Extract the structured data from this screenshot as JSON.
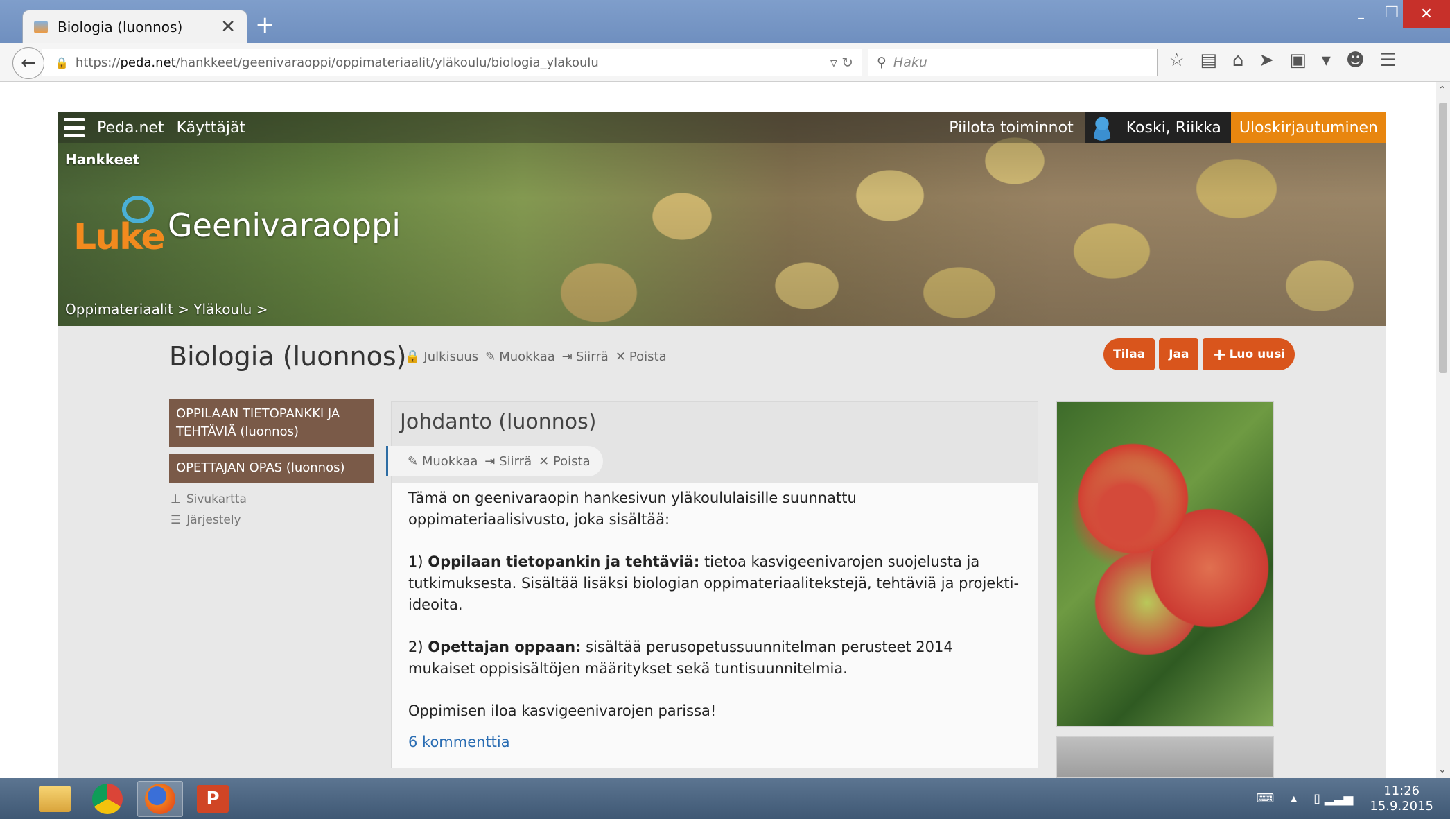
{
  "browser": {
    "tab_title": "Biologia (luonnos)",
    "new_tab": "+",
    "url_prefix": "https://",
    "url_host": "peda.net",
    "url_path": "/hankkeet/geenivaraoppi/oppimateriaalit/yläkoulu/biologia_ylakoulu",
    "search_placeholder": "Haku"
  },
  "site": {
    "topbar_links": [
      "Peda.net",
      "Käyttäjät"
    ],
    "hide_actions": "Piilota toiminnot",
    "user_name": "Koski, Riikka",
    "logout": "Uloskirjautuminen",
    "crumb_top": "Hankkeet",
    "logo_text": "Luke",
    "site_title": "Geenivaraoppi",
    "crumb_bottom": "Oppimateriaalit > Yläkoulu >"
  },
  "page": {
    "title": "Biologia (luonnos)",
    "actions": {
      "public": "Julkisuus",
      "edit": "Muokkaa",
      "move": "Siirrä",
      "delete": "Poista"
    },
    "buttons": {
      "subscribe": "Tilaa",
      "share": "Jaa",
      "create_new": "Luo uusi"
    }
  },
  "leftnav": {
    "items": [
      "OPPILAAN TIETOPANKKI JA TEHTÄVIÄ (luonnos)",
      "OPETTAJAN OPAS (luonnos)"
    ],
    "sitemap": "Sivukartta",
    "arrange": "Järjestely"
  },
  "content": {
    "title": "Johdanto (luonnos)",
    "actions": {
      "edit": "Muokkaa",
      "move": "Siirrä",
      "delete": "Poista"
    },
    "para1": "Tämä on geenivaraopin hankesivun yläkoululaisille suunnattu oppimateriaalisivusto, joka sisältää:",
    "para2_prefix": "1) ",
    "para2_bold": "Oppilaan tietopankin ja tehtäviä:",
    "para2_rest": " tietoa kasvigeenivarojen suojelusta ja tutkimuksesta. Sisältää lisäksi biologian oppimateriaalitekstejä, tehtäviä ja projekti-ideoita.",
    "para3_prefix": "2) ",
    "para3_bold": "Opettajan oppaan:",
    "para3_rest": " sisältää perusopetussuunnitelman perusteet 2014 mukaiset oppisisältöjen määritykset sekä tuntisuunnitelmia.",
    "para4": "Oppimisen iloa kasvigeenivarojen parissa!",
    "comments": "6 kommenttia"
  },
  "taskbar": {
    "ppt_label": "P",
    "time": "11:26",
    "date": "15.9.2015"
  }
}
